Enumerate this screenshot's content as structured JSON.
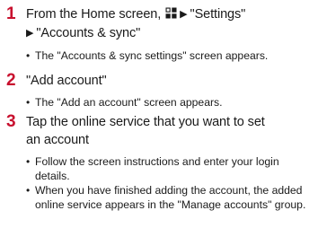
{
  "steps": [
    {
      "number": "1",
      "line1_prefix": "From the Home screen,",
      "icon": "apps-icon",
      "line1_arrow": "▶",
      "line1_suffix": "\"Settings\"",
      "line2_arrow": "▶",
      "line2_text": "\"Accounts & sync\"",
      "bullets": [
        "The \"Accounts & sync settings\" screen appears."
      ]
    },
    {
      "number": "2",
      "line1": "\"Add account\"",
      "bullets": [
        "The \"Add an account\" screen appears."
      ]
    },
    {
      "number": "3",
      "line1": "Tap the online service that you want to set",
      "line2": "an account",
      "bullets": [
        "Follow the screen instructions and enter your login details.",
        "When you have finished adding the account, the added online service appears in the \"Manage accounts\" group."
      ]
    }
  ],
  "colors": {
    "step_number": "#c8102e",
    "text": "#1a1a1a"
  }
}
